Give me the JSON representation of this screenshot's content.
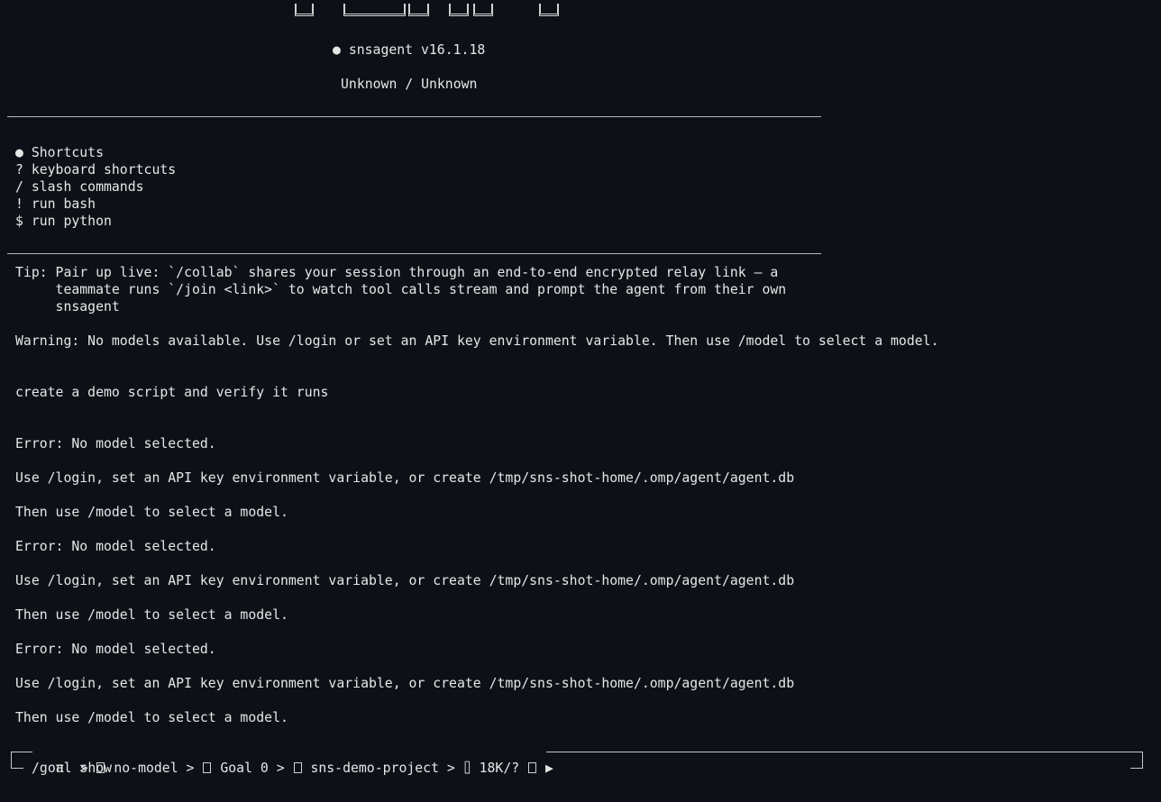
{
  "header": {
    "version": "● snsagent v16.1.18",
    "provider": "Unknown / Unknown"
  },
  "shortcuts": {
    "title": "● Shortcuts",
    "items": [
      "? keyboard shortcuts",
      "/ slash commands",
      "! run bash",
      "$ run python"
    ]
  },
  "tip": {
    "lines": [
      "Tip: Pair up live: `/collab` shares your session through an end-to-end encrypted relay link — a",
      "     teammate runs `/join <link>` to watch tool calls stream and prompt the agent from their own",
      "     snsagent"
    ]
  },
  "warning": "Warning: No models available. Use /login or set an API key environment variable. Then use /model to select a model.",
  "user_prompt": "create a demo script and verify it runs",
  "errors": [
    {
      "error": "Error: No model selected.",
      "hint": "Use /login, set an API key environment variable, or create /tmp/sns-shot-home/.omp/agent/agent.db",
      "then": "Then use /model to select a model."
    },
    {
      "error": "Error: No model selected.",
      "hint": "Use /login, set an API key environment variable, or create /tmp/sns-shot-home/.omp/agent/agent.db",
      "then": "Then use /model to select a model."
    },
    {
      "error": "Error: No model selected.",
      "hint": "Use /login, set an API key environment variable, or create /tmp/sns-shot-home/.omp/agent/agent.db",
      "then": "Then use /model to select a model."
    }
  ],
  "status": {
    "pi": "π",
    "sep": ">",
    "model": "no-model",
    "goal": "Goal 0",
    "project": "sns-demo-project",
    "context_icon": "⌷",
    "tokens": "18K/?",
    "play": "▶",
    "model_icon": "chip-icon",
    "goal_icon": "target-icon",
    "project_icon": "folder-icon"
  },
  "input": {
    "value": "/goal show"
  }
}
